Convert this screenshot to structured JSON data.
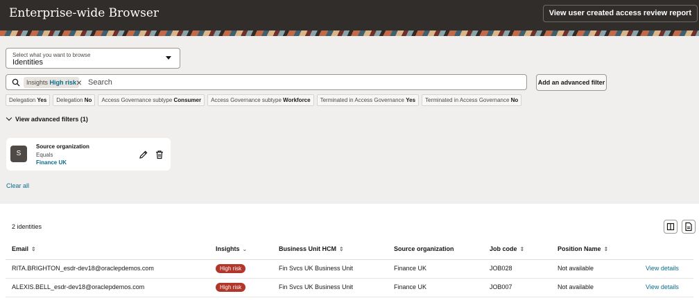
{
  "header": {
    "title": "Enterprise-wide Browser",
    "report_button": "View user created access review report"
  },
  "browse_select": {
    "label": "Select what you want to browse",
    "value": "Identities"
  },
  "search": {
    "chip_key": "Insights",
    "chip_value": "High risk",
    "placeholder": "Search",
    "value": ""
  },
  "advanced_filter_button": "Add an advanced filter",
  "suggestions": [
    {
      "key": "Delegation",
      "value": "Yes"
    },
    {
      "key": "Delegation",
      "value": "No"
    },
    {
      "key": "Access Governance subtype",
      "value": "Consumer"
    },
    {
      "key": "Access Governance subtype",
      "value": "Workforce"
    },
    {
      "key": "Terminated in Access Governance",
      "value": "Yes"
    },
    {
      "key": "Terminated in Access Governance",
      "value": "No"
    }
  ],
  "advanced_filters": {
    "toggle_label": "View advanced filters (1)",
    "card": {
      "avatar": "S",
      "name": "Source organization",
      "operator": "Equals",
      "value": "Finance UK"
    },
    "clear_all": "Clear all"
  },
  "results": {
    "count": "2 identities",
    "columns": [
      "Email",
      "Insights",
      "Business Unit HCM",
      "Source organization",
      "Job code",
      "Position Name"
    ],
    "rows": [
      {
        "email": "RITA.BRIGHTON_esdr-dev18@oraclepdemos.com",
        "insight": "High risk",
        "business_unit": "Fin Svcs UK Business Unit",
        "source_org": "Finance UK",
        "job_code": "JOB028",
        "position": "Not available",
        "action": "View details"
      },
      {
        "email": "ALEXIS.BELL_esdr-dev18@oraclepdemos.com",
        "insight": "High risk",
        "business_unit": "Fin Svcs UK Business Unit",
        "source_org": "Finance UK",
        "job_code": "JOB007",
        "position": "Not available",
        "action": "View details"
      }
    ]
  },
  "colors": {
    "header_bg": "#312d2a",
    "link": "#0b6b8a",
    "badge_high_risk": "#b2362a",
    "page_bg": "#f1efed"
  }
}
